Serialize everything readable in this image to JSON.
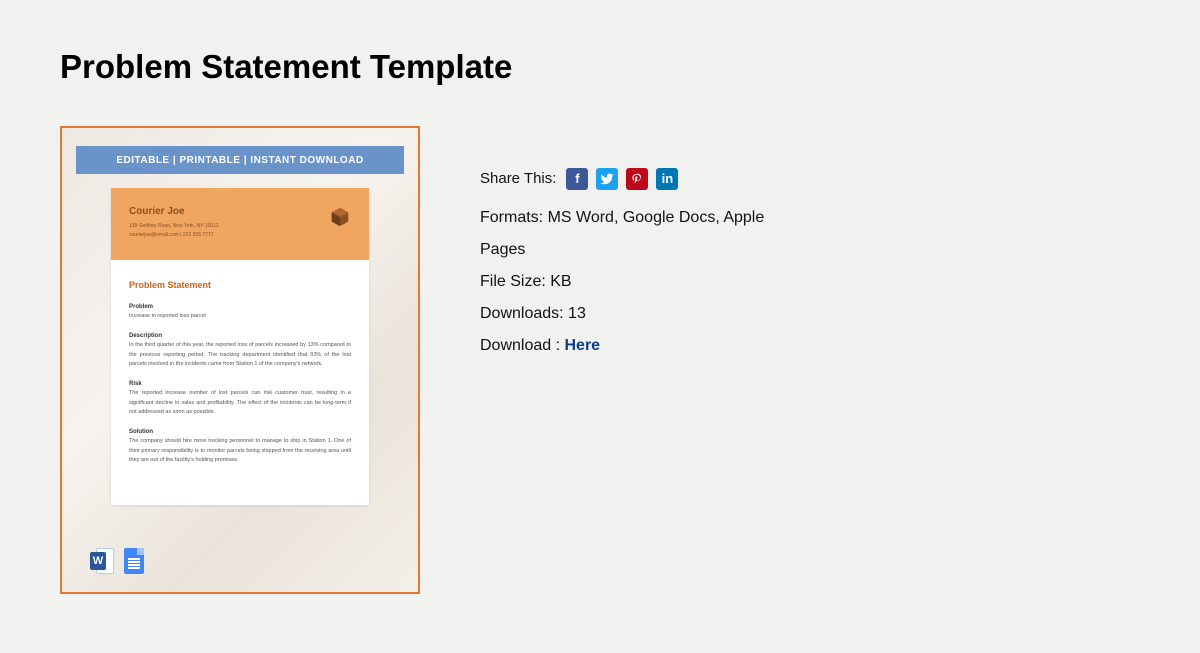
{
  "title": "Problem Statement Template",
  "preview": {
    "banner": "EDITABLE  |  PRINTABLE  |  INSTANT DOWNLOAD",
    "brand": "Courier Joe",
    "address": "139 Godfrey Road, New York, NY 10013",
    "contact": "courierjoe@email.com | 222 555 7777",
    "doc_title": "Problem Statement",
    "sections": {
      "problem": {
        "title": "Problem",
        "text": "Increase in reported loss parcel"
      },
      "description": {
        "title": "Description",
        "text": "In the third quarter of this year, the reported loss of parcels increased by 13% compared to the previous reporting period. The tracking department identified that 93% of the lost parcels involved in the incidents came from Station 1 of the company's network."
      },
      "risk": {
        "title": "Risk",
        "text": "The reported increase number of lost parcels can risk customer trust, resulting in a significant decline in sales and profitability. The effect of the incidents can be long-term if not addressed as soon as possible."
      },
      "solution": {
        "title": "Solution",
        "text": "The company should hire more tracking personnel to manage to ship in Station 1. One of their primary responsibility is to monitor parcels being shipped from the receiving area until they are out of the facility's holding premises."
      }
    }
  },
  "info": {
    "share_label": "Share This:",
    "formats_label": "Formats: ",
    "formats_value": "MS Word, Google Docs, Apple Pages",
    "filesize_label": "File Size: ",
    "filesize_value": "KB",
    "downloads_label": "Downloads: ",
    "downloads_value": "13",
    "download_label": "Download : ",
    "download_link": "Here"
  }
}
